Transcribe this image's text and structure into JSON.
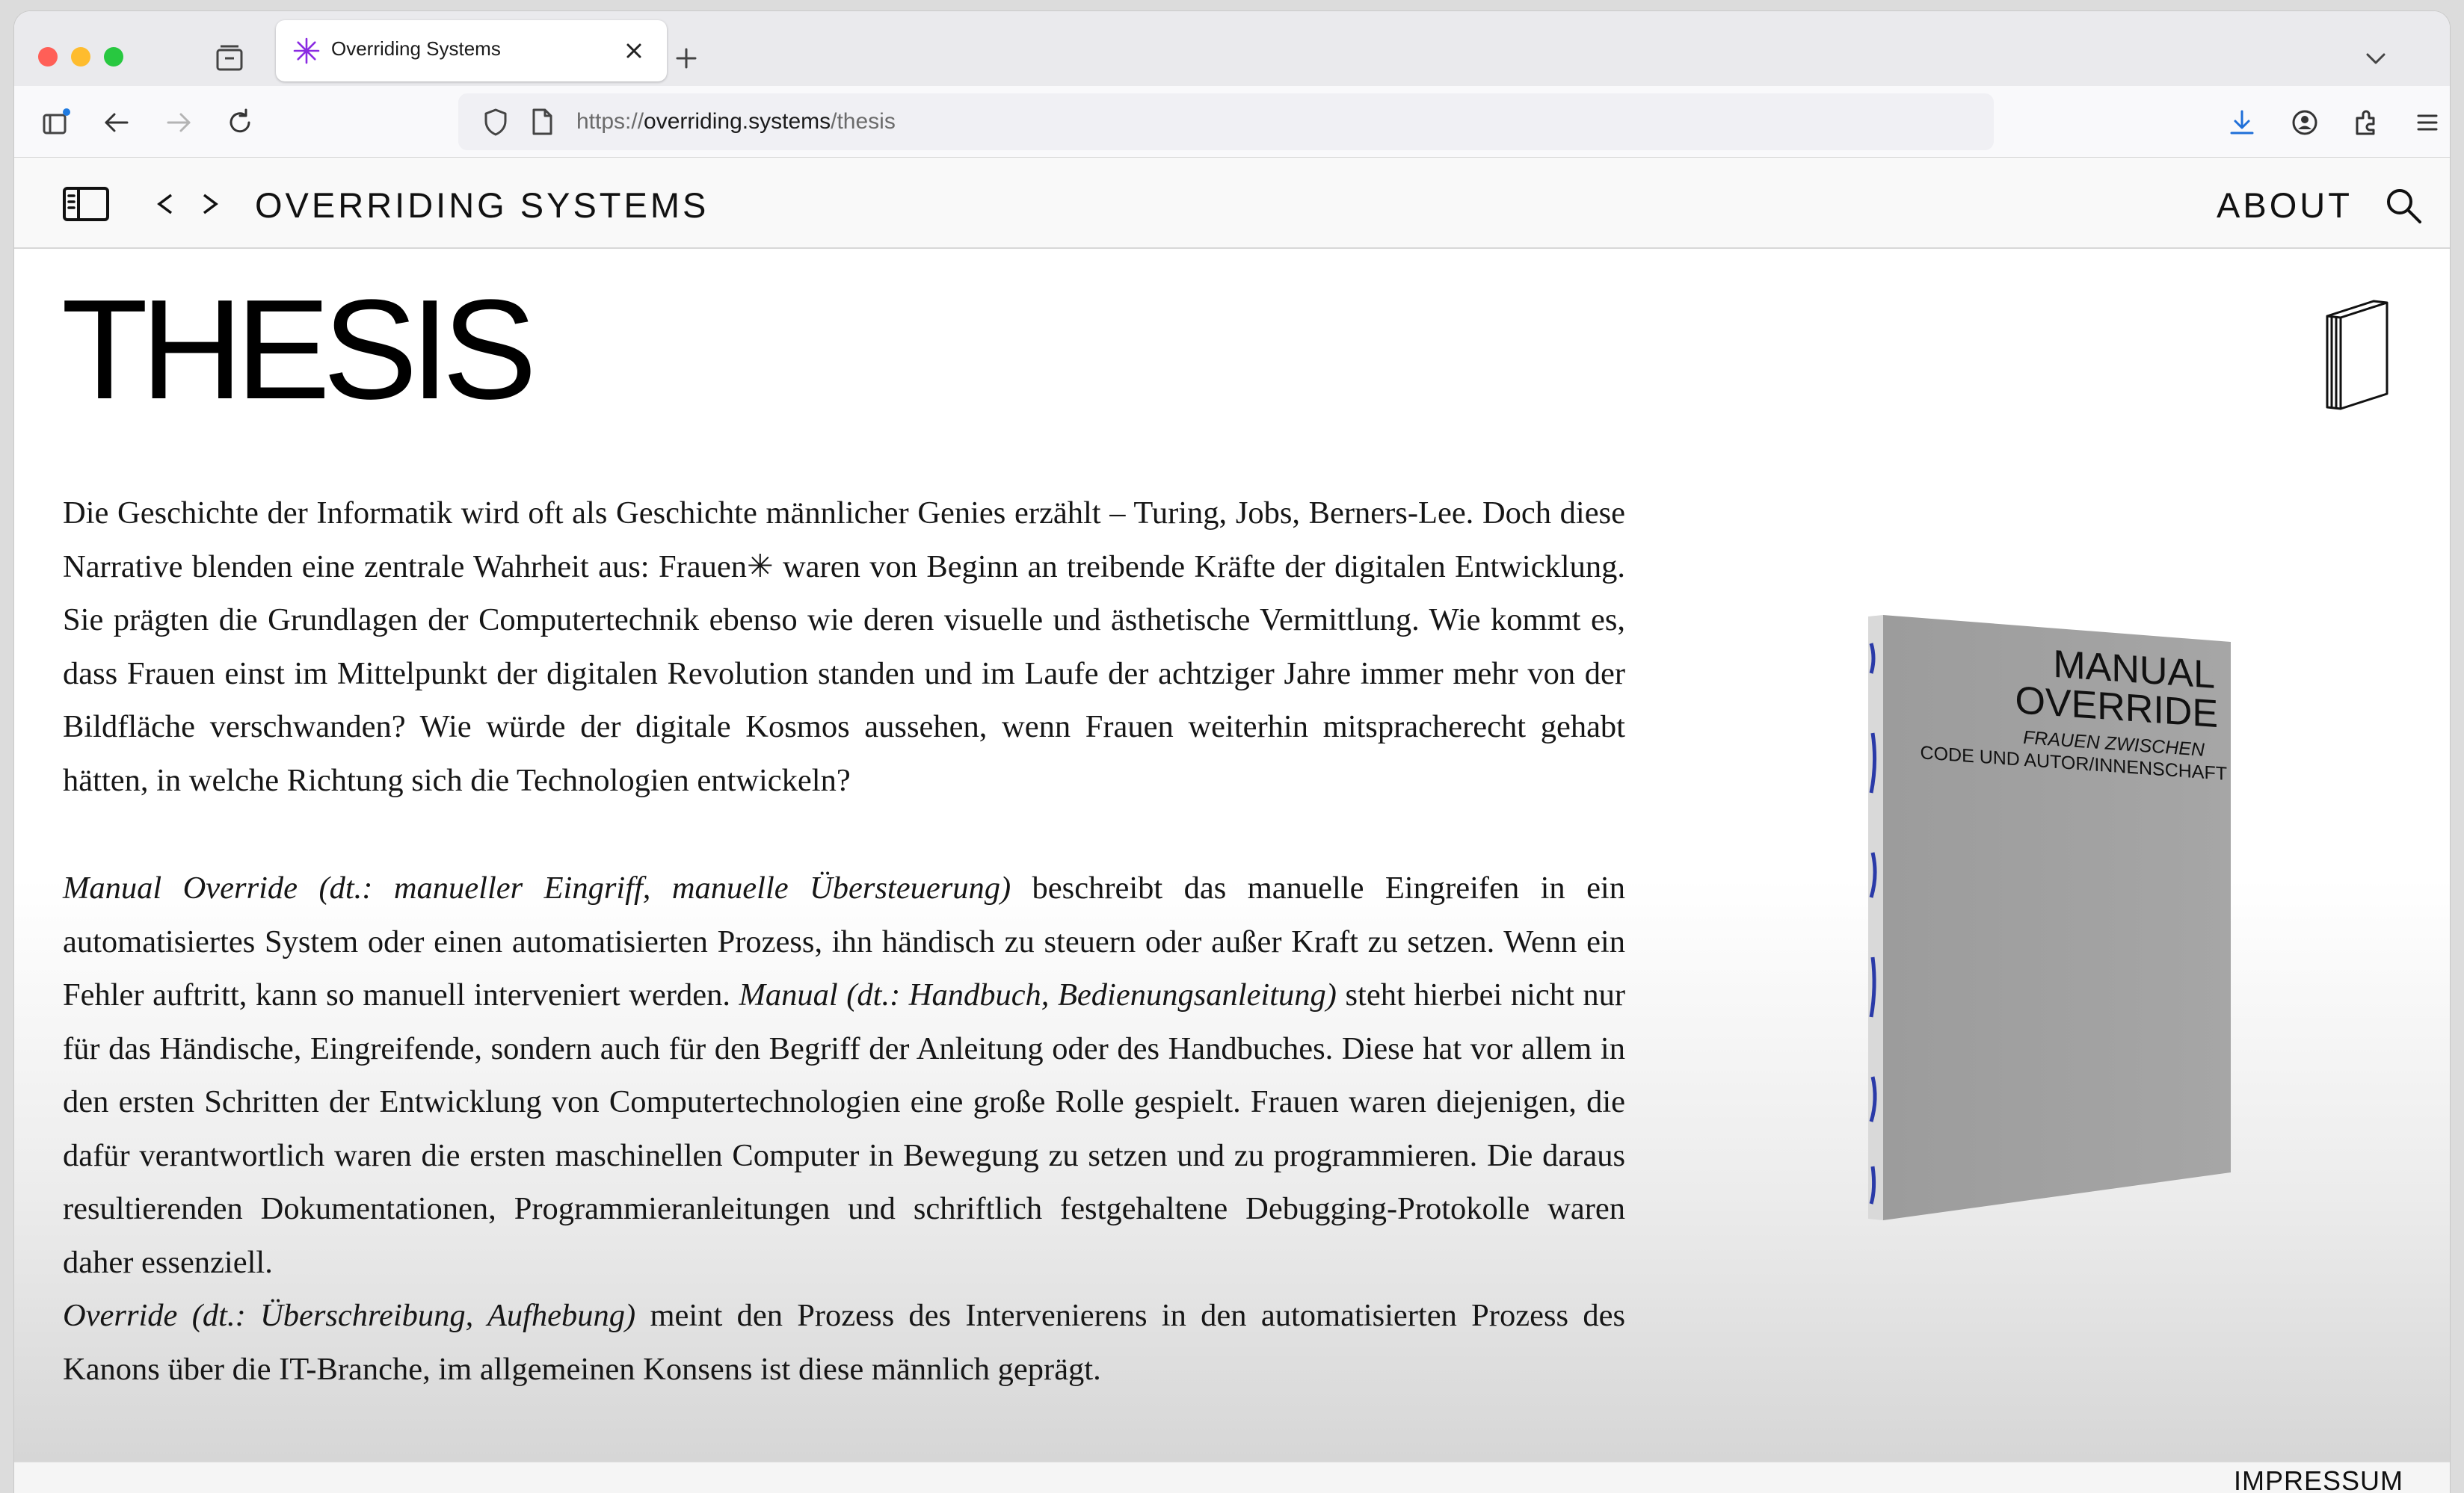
{
  "browser": {
    "tab_title": "Overriding Systems",
    "url_scheme": "https://",
    "url_host": "overriding.systems",
    "url_path": "/thesis"
  },
  "site": {
    "title": "OVERRIDING SYSTEMS",
    "about_label": "ABOUT",
    "footer_link": "IMPRESSUM"
  },
  "page": {
    "heading": "THESIS",
    "para1": "Die Geschichte der Informatik wird oft als Geschichte männlicher Genies erzählt – Turing, Jobs, Berners-Lee. Doch diese Narrative blenden eine zentrale Wahrheit aus: Frauen✳ waren von Beginn an treibende Kräfte der digitalen Entwicklung. Sie prägten die Grundlagen der Computertechnik ebenso wie deren visuelle und ästhetische Vermittlung. Wie kommt es, dass Frauen einst im Mittelpunkt der digitalen Revolution standen und im Laufe der achtziger Jahre immer mehr von der Bildfläche verschwanden? Wie würde der digitale Kosmos aussehen, wenn Frauen weiterhin mitspracherecht gehabt hätten, in welche Richtung sich die Technologien entwickeln?",
    "para2_em1": "Manual Override (dt.: manueller Eingriff, manuelle Übersteuerung)",
    "para2_text1": " beschreibt das manuelle Eingreifen in ein automatisiertes System oder einen automatisierten Prozess, ihn händisch zu steuern oder außer Kraft zu setzen. Wenn ein Fehler auftritt, kann so manuell interveniert werden. ",
    "para2_em2": "Manual (dt.: Handbuch, Bedienungsanleitung)",
    "para2_text2": " steht hierbei nicht nur für das Händische, Eingreifende, sondern auch für den Begriff der Anleitung oder des Handbuches. Diese hat vor allem in den ersten Schritten der Entwicklung von Computertechnologien eine große Rolle gespielt. Frauen waren diejenigen, die dafür verantwortlich waren die ersten maschinellen Computer in Bewegung zu setzen und zu programmieren. Die daraus resultierenden Dokumentationen, Programmieranleitungen und schriftlich festgehaltene Debugging-Protokolle waren daher essenziell.",
    "para3_em": "Override (dt.: Überschreibung, Aufhebung)",
    "para3_text": " meint den Prozess des Intervenierens in den automatisierten Prozess des Kanons über die IT-Branche, im allgemeinen Konsens ist diese männlich geprägt."
  },
  "book_cover": {
    "line1": "MANUAL",
    "line2": "OVERRIDE",
    "line3": "FRAUEN ZWISCHEN",
    "line4": "CODE UND AUTOR/INNENSCHAFT",
    "cover_color": "#9a9a9a",
    "binding_color": "#2a3aa8"
  },
  "icons": {
    "favicon": "asterisk-icon",
    "accent": "#8a2be2"
  }
}
